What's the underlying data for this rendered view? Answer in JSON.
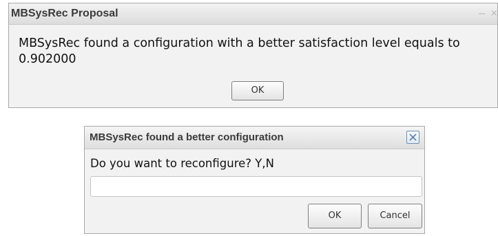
{
  "proposal_dialog": {
    "title": "MBSysRec Proposal",
    "minimize_symbol": "–",
    "close_symbol": "×",
    "message": "MBSysRec found a configuration with a better satisfaction level equals to 0.902000",
    "ok_label": "OK"
  },
  "reconfigure_dialog": {
    "title": "MBSysRec found a better configuration",
    "question": "Do you want to reconfigure? Y,N",
    "input_value": "",
    "ok_label": "OK",
    "cancel_label": "Cancel"
  },
  "icons": {
    "close": "close-icon",
    "minimize": "minimize-icon"
  },
  "colors": {
    "dialog_background": "#f2f2f2",
    "titlebar_text": "#3b3b3b",
    "close_button_border": "#6f8fb5"
  }
}
